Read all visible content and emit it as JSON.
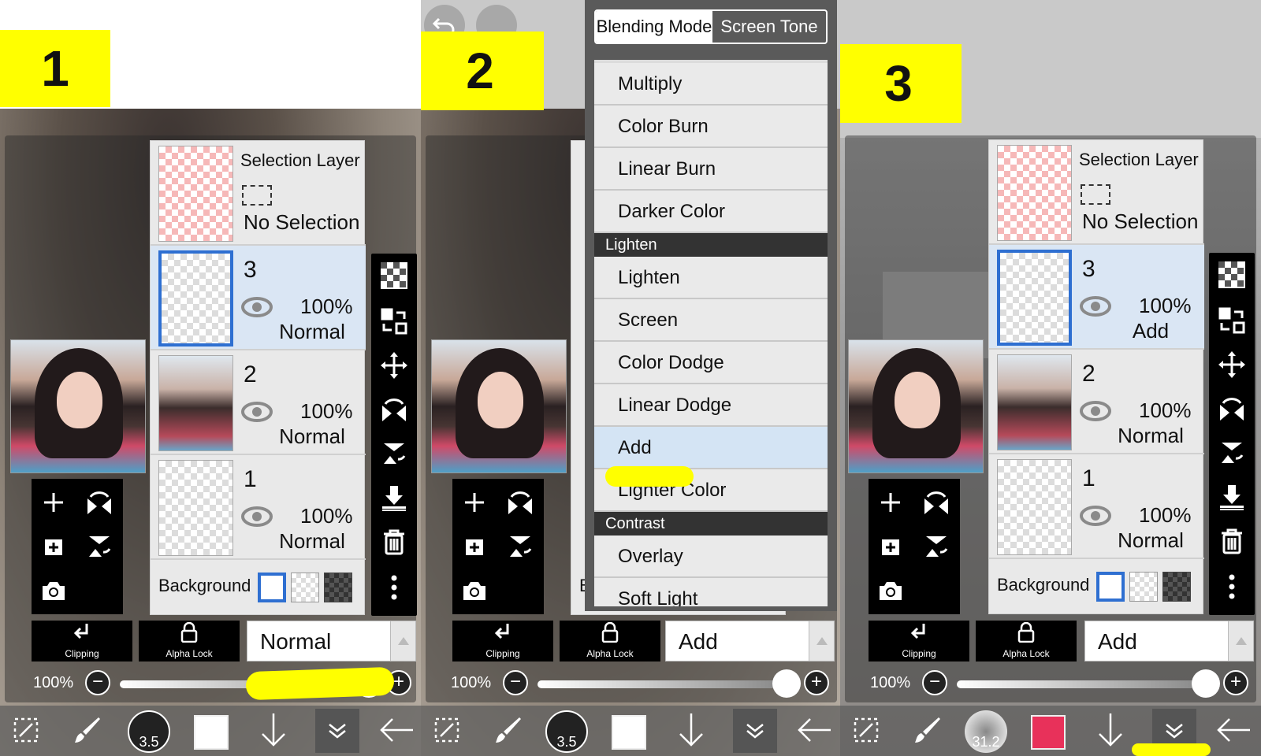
{
  "panels": [
    {
      "badge": "1",
      "selection_layer": {
        "title": "Selection Layer",
        "status": "No Selection"
      },
      "layers": [
        {
          "name": "3",
          "opacity": "100%",
          "mode": "Normal",
          "selected": true
        },
        {
          "name": "2",
          "opacity": "100%",
          "mode": "Normal",
          "selected": false
        },
        {
          "name": "1",
          "opacity": "100%",
          "mode": "Normal",
          "selected": false
        }
      ],
      "background_label": "Background",
      "clipping_label": "Clipping",
      "alpha_lock_label": "Alpha Lock",
      "blend_mode": "Normal",
      "opacity_label": "100%",
      "brush_size": "3.5",
      "color": "#ffffff"
    },
    {
      "badge": "2",
      "menu": {
        "tabs": [
          "Blending Mode",
          "Screen Tone"
        ],
        "items": [
          "Multiply",
          "Color Burn",
          "Linear Burn",
          "Darker Color"
        ],
        "header_lighten": "Lighten",
        "lighten_items": [
          "Lighten",
          "Screen",
          "Color Dodge",
          "Linear Dodge",
          "Add",
          "Lighter Color"
        ],
        "header_contrast": "Contrast",
        "contrast_items": [
          "Overlay",
          "Soft Light"
        ],
        "highlighted": "Add"
      },
      "background_partial": "Ba",
      "clipping_label": "Clipping",
      "alpha_lock_label": "Alpha Lock",
      "blend_mode": "Add",
      "opacity_label": "100%",
      "brush_size": "3.5",
      "color": "#ffffff"
    },
    {
      "badge": "3",
      "selection_layer": {
        "title": "Selection Layer",
        "status": "No Selection"
      },
      "layers": [
        {
          "name": "3",
          "opacity": "100%",
          "mode": "Add",
          "selected": true
        },
        {
          "name": "2",
          "opacity": "100%",
          "mode": "Normal",
          "selected": false
        },
        {
          "name": "1",
          "opacity": "100%",
          "mode": "Normal",
          "selected": false
        }
      ],
      "background_label": "Background",
      "clipping_label": "Clipping",
      "alpha_lock_label": "Alpha Lock",
      "blend_mode": "Add",
      "opacity_label": "100%",
      "brush_size": "31.2",
      "color": "#e8315a"
    }
  ],
  "colors": {
    "highlight": "#ffff00",
    "selection_border": "#2e6fd1",
    "selected_row": "#dae6f4"
  },
  "icons": [
    "plus-icon",
    "flip-horizontal-icon",
    "add-layer-icon",
    "flip-vertical-icon",
    "camera-icon",
    "checker-icon",
    "transfer-icon",
    "move-icon",
    "rotate-flip-icon",
    "download-icon",
    "trash-icon",
    "more-icon",
    "undo-icon",
    "eye-icon"
  ]
}
